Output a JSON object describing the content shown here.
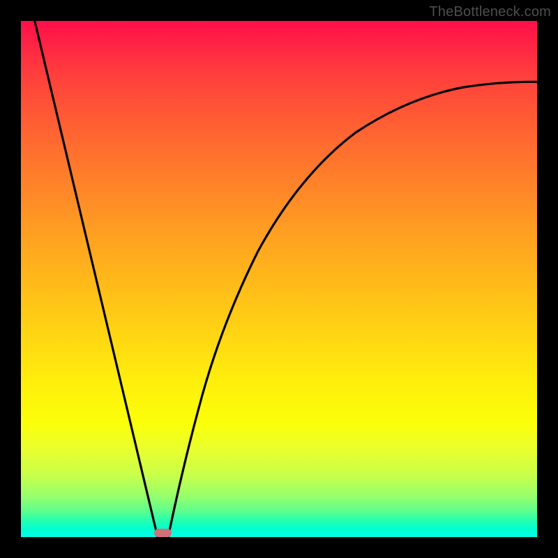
{
  "watermark": "TheBottleneck.com",
  "chart_data": {
    "type": "line",
    "title": "",
    "xlabel": "",
    "ylabel": "",
    "xlim": [
      0,
      100
    ],
    "ylim": [
      0,
      100
    ],
    "grid": false,
    "background_gradient": {
      "orientation": "vertical",
      "stops": [
        {
          "at": 0,
          "color": "#ff0e49"
        },
        {
          "at": 10,
          "color": "#ff3d3d"
        },
        {
          "at": 20,
          "color": "#ff5f33"
        },
        {
          "at": 30,
          "color": "#ff7e2a"
        },
        {
          "at": 40,
          "color": "#ff9c22"
        },
        {
          "at": 50,
          "color": "#ffb81a"
        },
        {
          "at": 60,
          "color": "#ffd313"
        },
        {
          "at": 70,
          "color": "#ffef0c"
        },
        {
          "at": 80,
          "color": "#f2ff18"
        },
        {
          "at": 90,
          "color": "#a0ff60"
        },
        {
          "at": 100,
          "color": "#00ffe9"
        }
      ]
    },
    "series": [
      {
        "name": "left-branch",
        "x": [
          2,
          26.5
        ],
        "y": [
          100,
          0
        ],
        "note": "straight descending line from top-left region down to marker at ~26.5% x"
      },
      {
        "name": "right-branch",
        "x": [
          28.5,
          33,
          38,
          45,
          55,
          65,
          75,
          85,
          100
        ],
        "y": [
          0,
          19,
          37,
          55,
          70,
          78,
          82.5,
          85.5,
          88
        ],
        "note": "concave curve rising from marker toward upper right"
      }
    ],
    "marker": {
      "x": 27.5,
      "y": 0,
      "shape": "rounded-rect",
      "color": "#d0717a",
      "width": 3.4,
      "height": 1.6
    }
  }
}
